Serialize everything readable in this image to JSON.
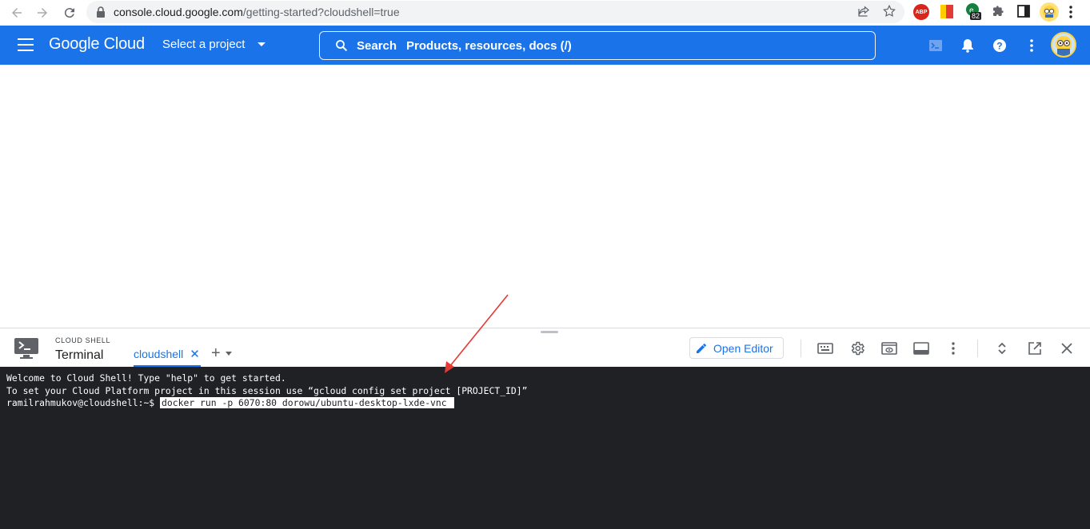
{
  "browser": {
    "url_host": "console.cloud.google.com",
    "url_path": "/getting-started?cloudshell=true",
    "extensions": [
      "back-icon",
      "forward-icon",
      "reload-icon",
      "lock-icon",
      "share-icon",
      "star-icon",
      "adblock-icon",
      "bookmark-flag-icon",
      "grammar-extension-icon",
      "puzzle-icon",
      "sidebar-icon",
      "profile-avatar",
      "kebab-menu-icon"
    ],
    "badge_count": "82",
    "adblock_label": "ABP"
  },
  "header": {
    "logo_text": "Google Cloud",
    "project_label": "Select a project",
    "search_label": "Search",
    "search_placeholder": "Products, resources, docs (/)",
    "accent_color": "#1a73e8"
  },
  "shell": {
    "section_label": "CLOUD SHELL",
    "title": "Terminal",
    "tab_label": "cloudshell",
    "tab_close": "✕",
    "add_tab": "+",
    "open_editor_label": "Open Editor",
    "toolbar_icons": [
      "keyboard-icon",
      "settings-gear-icon",
      "web-preview-icon",
      "terminal-layout-icon",
      "more-vert-icon",
      "restore-icon",
      "open-new-window-icon",
      "close-icon"
    ]
  },
  "terminal": {
    "line1": "Welcome to Cloud Shell! Type \"help\" to get started.",
    "line2": "To set your Cloud Platform project in this session use “gcloud config set project [PROJECT_ID]”",
    "prompt": "ramilrahmukov@cloudshell:~$ ",
    "command": "docker run -p 6070:80 dorowu/ubuntu-desktop-lxde-vnc "
  }
}
